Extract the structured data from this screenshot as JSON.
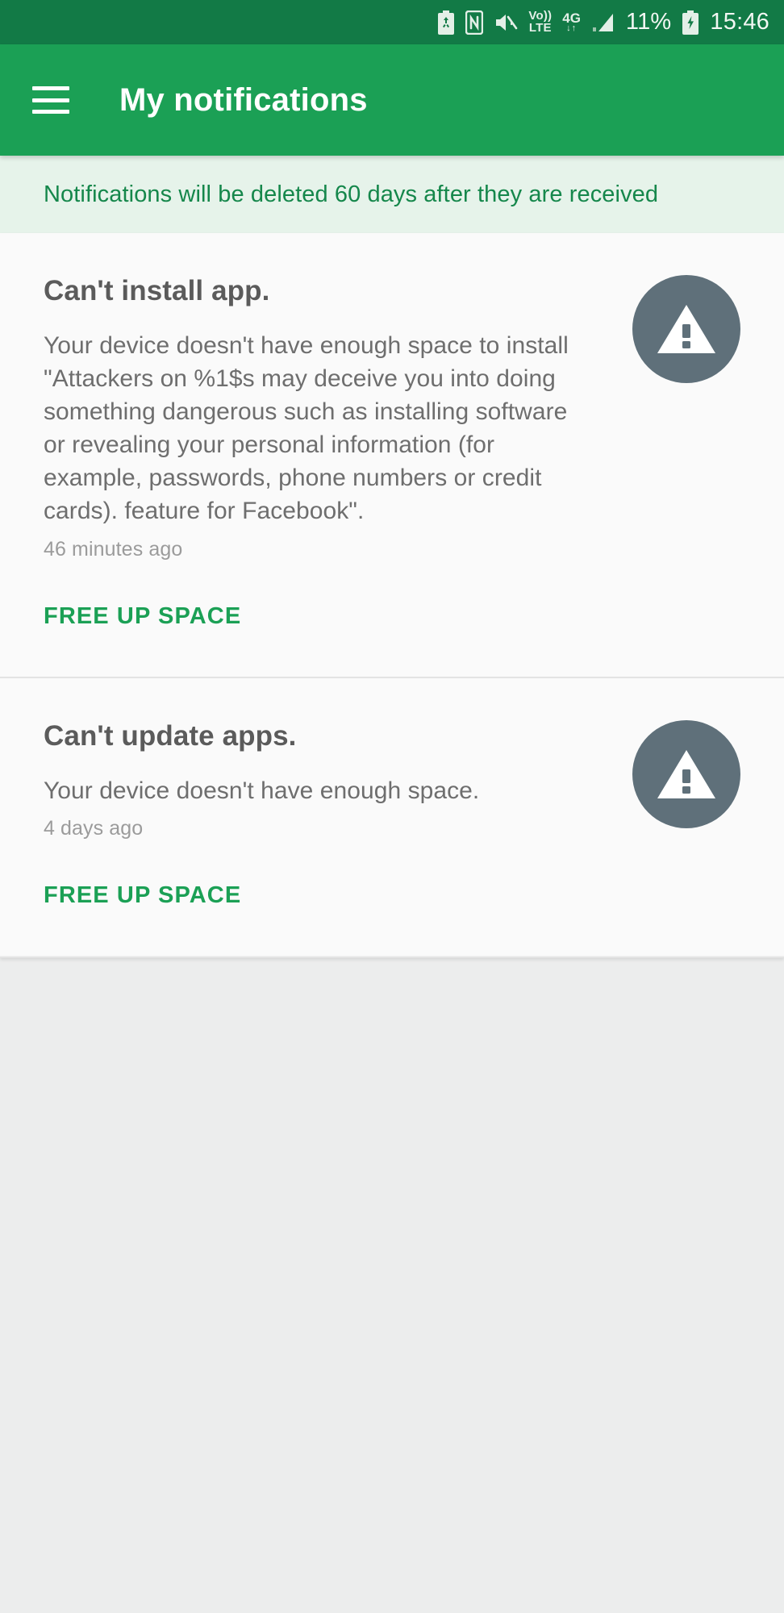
{
  "status_bar": {
    "icons": [
      {
        "name": "battery-saver-icon",
        "label": "battery saver"
      },
      {
        "name": "nfc-icon",
        "label": "NFC"
      },
      {
        "name": "mute-icon",
        "label": "ringer muted"
      },
      {
        "name": "volte-icon",
        "line1": "Vo))",
        "line2": "LTE"
      },
      {
        "name": "data-4g-icon",
        "label": "4G",
        "arrows": "↓↑"
      },
      {
        "name": "signal-strength-icon",
        "label": "signal"
      }
    ],
    "battery_percent": "11%",
    "battery_charging_icon": "battery-charging-icon",
    "clock": "15:46"
  },
  "app_bar": {
    "menu_icon": "hamburger-menu-icon",
    "title": "My notifications"
  },
  "banner": {
    "text": "Notifications will be deleted 60 days after they are received"
  },
  "notifications": [
    {
      "title": "Can't install app.",
      "body": "Your device doesn't have enough space to install \"Attackers on %1$s may deceive you into doing something dangerous such as installing software or revealing your personal information (for example, passwords, phone numbers or credit cards). feature for Facebook\".",
      "time": "46 minutes ago",
      "action": "FREE UP SPACE",
      "icon": "warning-triangle-icon"
    },
    {
      "title": "Can't update apps.",
      "body": "Your device doesn't have enough space.",
      "time": "4 days ago",
      "action": "FREE UP SPACE",
      "icon": "warning-triangle-icon"
    }
  ],
  "colors": {
    "status_bar_green": "#127a46",
    "app_bar_green": "#1ba055",
    "banner_bg": "#e6f3ea",
    "banner_text": "#15874b",
    "action_green": "#1ba055",
    "badge_slate": "#5f707a",
    "list_bg": "#fafafa",
    "empty_bg": "#ebebeb"
  }
}
